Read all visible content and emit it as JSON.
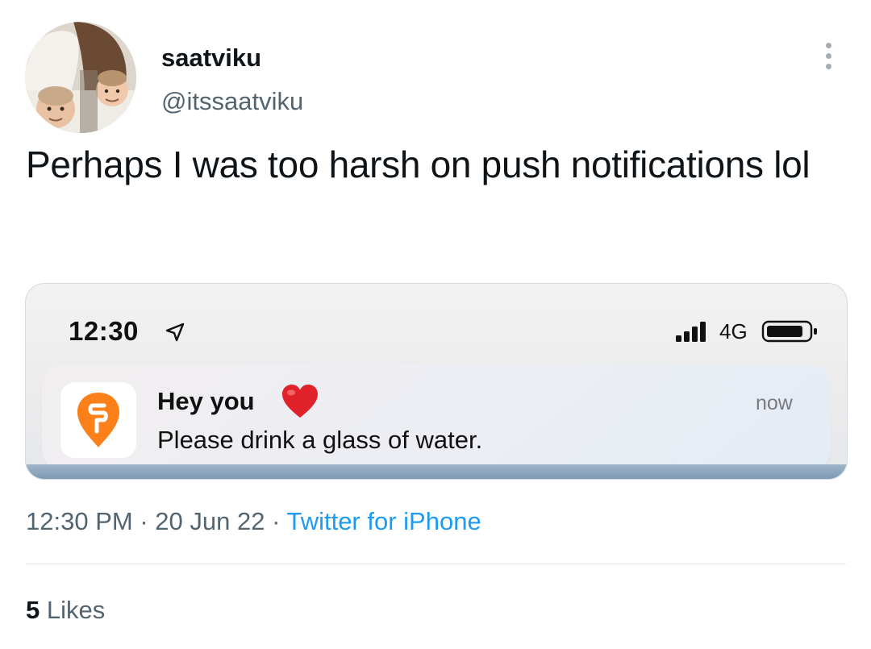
{
  "author": {
    "display_name": "saatviku",
    "handle": "@itssaatviku"
  },
  "tweet": {
    "text": "Perhaps I was too harsh on push notifications lol"
  },
  "media": {
    "status_bar": {
      "time": "12:30",
      "network": "4G",
      "icons": [
        "location-arrow-icon",
        "signal-bars-icon",
        "battery-icon"
      ]
    },
    "notification": {
      "app_icon": "swiggy-app-icon",
      "title": "Hey you",
      "emoji_icon": "red-heart-icon",
      "body": "Please drink a glass of water.",
      "time": "now"
    }
  },
  "meta": {
    "time": "12:30 PM",
    "separator": "·",
    "date": "20 Jun 22",
    "source": "Twitter for iPhone"
  },
  "engagement": {
    "likes_count": "5",
    "likes_label": "Likes"
  },
  "colors": {
    "text_primary": "#0f1419",
    "text_secondary": "#536471",
    "link": "#1d9bf0",
    "swiggy_orange": "#fc8019",
    "heart_red": "#e0222b"
  }
}
